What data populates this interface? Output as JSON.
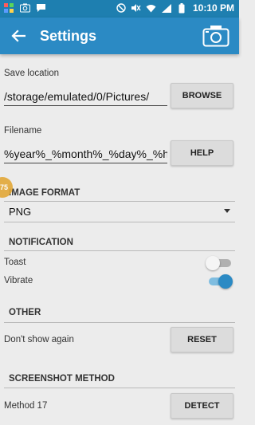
{
  "status_bar": {
    "left_icons": [
      "grid-icon",
      "photo-icon",
      "chat-icon"
    ],
    "right_icons": [
      "do-not-disturb-icon",
      "mute-icon",
      "wifi-icon",
      "signal-icon",
      "battery-icon"
    ],
    "time": "10:10 PM"
  },
  "app_bar": {
    "title": "Settings",
    "back_icon": "arrow-left-icon",
    "action_icon": "camera-icon",
    "color": "#2b8ac4"
  },
  "save_location": {
    "label": "Save location",
    "value": "/storage/emulated/0/Pictures/",
    "button": "BROWSE"
  },
  "filename": {
    "label": "Filename",
    "value": "%year%_%month%_%day%_%h",
    "button": "HELP"
  },
  "edge_badge": "75",
  "image_format": {
    "header": "IMAGE FORMAT",
    "selected": "PNG"
  },
  "notification": {
    "header": "NOTIFICATION",
    "toast_label": "Toast",
    "toast_on": false,
    "vibrate_label": "Vibrate",
    "vibrate_on": true
  },
  "other": {
    "header": "OTHER",
    "label": "Don't show again",
    "button": "RESET"
  },
  "screenshot_method": {
    "header": "SCREENSHOT METHOD",
    "label": "Method 17",
    "button": "DETECT"
  }
}
